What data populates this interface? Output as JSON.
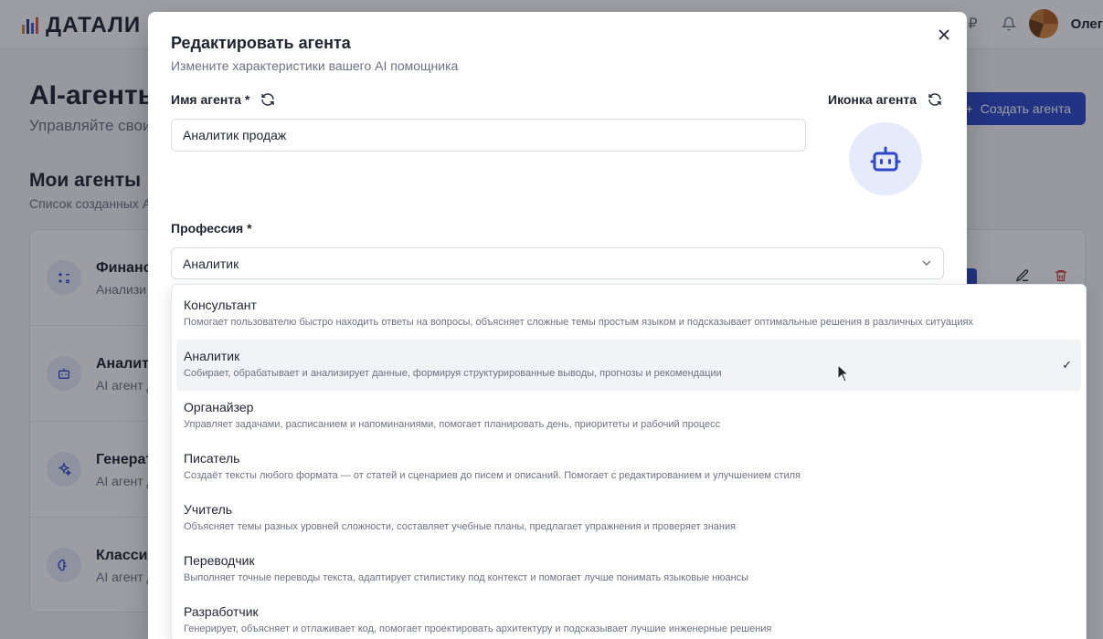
{
  "app": {
    "logo_text": "ДАТАЛИ",
    "currency_symbol": "₽",
    "user_name": "Олег"
  },
  "page": {
    "title": "AI-агенты",
    "subtitle": "Управляйте свои",
    "create_button": "Создать агента",
    "section_title": "Мои агенты",
    "section_subtitle": "Список созданных А"
  },
  "agents": [
    {
      "name": "Финанс",
      "desc": "Анализи",
      "icon": "calculator-icon"
    },
    {
      "name": "Аналит",
      "desc": "AI агент д",
      "icon": "bot-icon"
    },
    {
      "name": "Генерат",
      "desc": "AI агент д",
      "icon": "sparkles-icon"
    },
    {
      "name": "Классис",
      "desc": "AI агент д",
      "icon": "brain-icon"
    }
  ],
  "modal": {
    "title": "Редактировать агента",
    "subtitle": "Измените характеристики вашего AI помощника",
    "name_label": "Имя агента *",
    "name_value": "Аналитик продаж",
    "icon_label": "Иконка агента",
    "profession_label": "Профессия *",
    "profession_value": "Аналитик"
  },
  "dropdown": {
    "options": [
      {
        "label": "Консультант",
        "desc": "Помогает пользователю быстро находить ответы на вопросы, объясняет сложные темы простым языком и подсказывает оптимальные решения в различных ситуациях"
      },
      {
        "label": "Аналитик",
        "desc": "Собирает, обрабатывает и анализирует данные, формируя структурированные выводы, прогнозы и рекомендации",
        "check": "✓"
      },
      {
        "label": "Органайзер",
        "desc": "Управляет задачами, расписанием и напоминаниями, помогает планировать день, приоритеты и рабочий процесс"
      },
      {
        "label": "Писатель",
        "desc": "Создаёт тексты любого формата — от статей и сценариев до писем и описаний. Помогает с редактированием и улучшением стиля"
      },
      {
        "label": "Учитель",
        "desc": "Объясняет темы разных уровней сложности, составляет учебные планы, предлагает упражнения и проверяет знания"
      },
      {
        "label": "Переводчик",
        "desc": "Выполняет точные переводы текста, адаптирует стилистику под контекст и помогает лучше понимать языковые нюансы"
      },
      {
        "label": "Разработчик",
        "desc": "Генерирует, объясняет и отлаживает код, помогает проектировать архитектуру и подсказывает лучшие инженерные решения"
      }
    ],
    "selected_index": 1
  },
  "colors": {
    "accent": "#2f47c9",
    "icon_bg": "#e6ebfb",
    "danger": "#d63b3b"
  }
}
